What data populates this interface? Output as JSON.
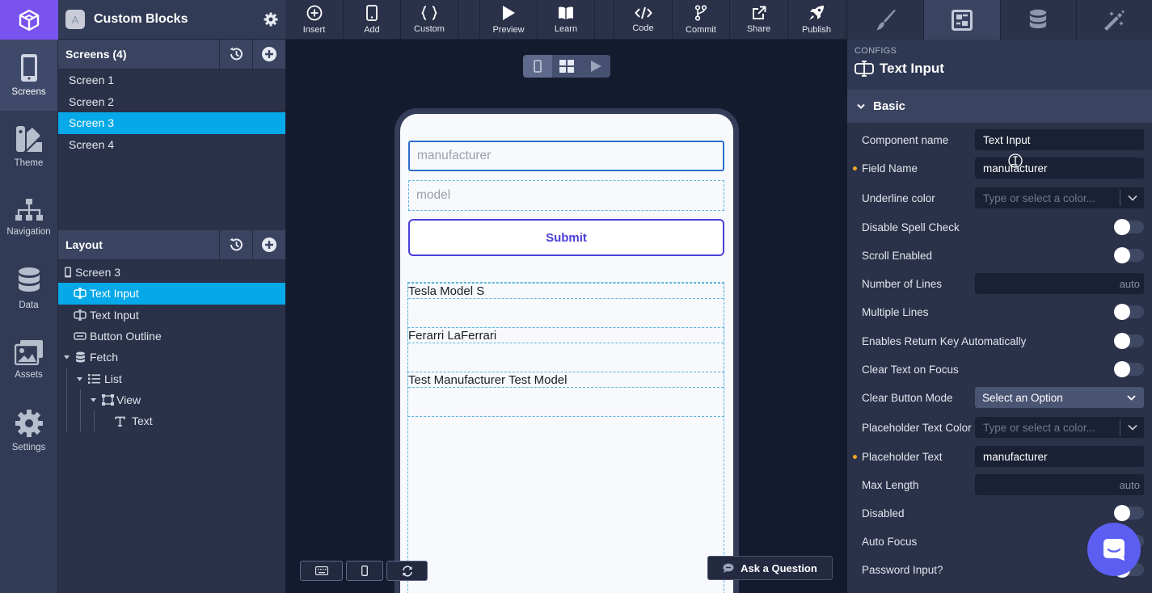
{
  "project": {
    "initial": "A",
    "name": "Custom Blocks"
  },
  "nav": [
    {
      "label": "Screens",
      "icon": "phone-icon"
    },
    {
      "label": "Theme",
      "icon": "theme-icon"
    },
    {
      "label": "Navigation",
      "icon": "sitemap-icon"
    },
    {
      "label": "Data",
      "icon": "database-icon"
    },
    {
      "label": "Assets",
      "icon": "images-icon"
    },
    {
      "label": "Settings",
      "icon": "gear-icon"
    }
  ],
  "screens": {
    "title": "Screens (4)",
    "items": [
      "Screen 1",
      "Screen 2",
      "Screen 3",
      "Screen 4"
    ],
    "selected": "Screen 3"
  },
  "layout": {
    "title": "Layout",
    "items": [
      {
        "label": "Screen 3",
        "icon": "phone-small-icon"
      },
      {
        "label": "Text Input",
        "icon": "text-input-icon"
      },
      {
        "label": "Text Input",
        "icon": "text-input-icon"
      },
      {
        "label": "Button Outline",
        "icon": "button-icon"
      },
      {
        "label": "Fetch",
        "icon": "database-small-icon"
      },
      {
        "label": "List",
        "icon": "list-icon"
      },
      {
        "label": "View",
        "icon": "view-icon"
      },
      {
        "label": "Text",
        "icon": "text-icon"
      }
    ]
  },
  "toolbar": [
    {
      "label": "Insert",
      "icon": "plus-circle-icon"
    },
    {
      "label": "Add",
      "icon": "mobile-icon"
    },
    {
      "label": "Custom",
      "icon": "braces-icon"
    },
    {
      "label": "Preview",
      "icon": "play-icon"
    },
    {
      "label": "Learn",
      "icon": "book-icon"
    },
    {
      "label": "Code",
      "icon": "code-icon"
    },
    {
      "label": "Commit",
      "icon": "branch-icon"
    },
    {
      "label": "Share",
      "icon": "external-link-icon"
    },
    {
      "label": "Publish",
      "icon": "rocket-icon"
    }
  ],
  "right_tabs": [
    "paint-brush-icon",
    "config-icon",
    "database-icon",
    "magic-wand-icon"
  ],
  "preview": {
    "manufacturer_placeholder": "manufacturer",
    "model_placeholder": "model",
    "submit_label": "Submit",
    "list": [
      "Tesla Model S",
      "Ferarri LaFerrari",
      "Test Manufacturer Test Model"
    ]
  },
  "ask_label": "Ask a Question",
  "config": {
    "section_label": "CONFIGS",
    "title": "Text Input",
    "group": "Basic",
    "rows": [
      {
        "label": "Component name",
        "type": "text",
        "value": "Text Input"
      },
      {
        "label": "Field Name",
        "type": "text",
        "value": "manufacturer",
        "modified": true
      },
      {
        "label": "Underline color",
        "type": "color",
        "placeholder": "Type or select a color..."
      },
      {
        "label": "Disable Spell Check",
        "type": "toggle",
        "on": false
      },
      {
        "label": "Scroll Enabled",
        "type": "toggle",
        "on": false
      },
      {
        "label": "Number of Lines",
        "type": "auto",
        "value": "auto"
      },
      {
        "label": "Multiple Lines",
        "type": "toggle",
        "on": false
      },
      {
        "label": "Enables Return Key Automatically",
        "type": "toggle",
        "on": false
      },
      {
        "label": "Clear Text on Focus",
        "type": "toggle",
        "on": false
      },
      {
        "label": "Clear Button Mode",
        "type": "select",
        "value": "Select an Option"
      },
      {
        "label": "Placeholder Text Color",
        "type": "color",
        "placeholder": "Type or select a color..."
      },
      {
        "label": "Placeholder Text",
        "type": "text",
        "value": "manufacturer",
        "modified": true
      },
      {
        "label": "Max Length",
        "type": "auto",
        "value": "auto"
      },
      {
        "label": "Disabled",
        "type": "toggle",
        "on": false
      },
      {
        "label": "Auto Focus",
        "type": "toggle",
        "on": false
      },
      {
        "label": "Password Input?",
        "type": "toggle",
        "on": false
      }
    ]
  },
  "colors": {
    "brand": "#7a52ee",
    "selection": "#05a8e8",
    "submit": "#4a3fd6",
    "chat": "#5b5ef0",
    "modified_dot": "#f5a623"
  }
}
